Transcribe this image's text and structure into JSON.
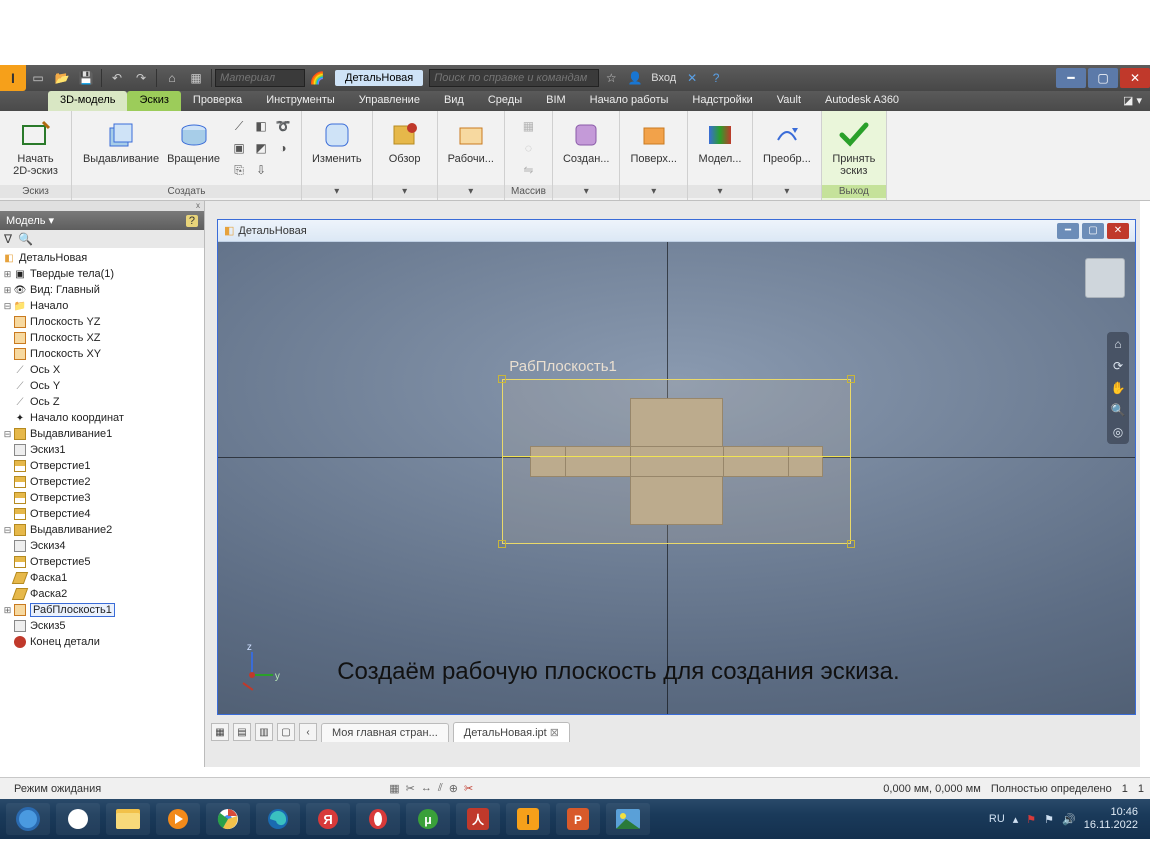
{
  "qat": {
    "logo": "I",
    "material_placeholder": "Материал",
    "doc_tab": "ДетальНовая",
    "search_placeholder": "Поиск по справке и командам",
    "login": "Вход"
  },
  "tabs": {
    "t3d": "3D-модель",
    "sketch": "Эскиз",
    "check": "Проверка",
    "tools": "Инструменты",
    "manage": "Управление",
    "view": "Вид",
    "env": "Среды",
    "bim": "BIM",
    "start": "Начало работы",
    "addins": "Надстройки",
    "vault": "Vault",
    "a360": "Autodesk A360"
  },
  "ribbon": {
    "sketch_panel": "Эскиз",
    "start_sketch": "Начать\n2D-эскиз",
    "create_panel": "Создать",
    "extrude": "Выдавливание",
    "revolve": "Вращение",
    "modify": "Изменить",
    "explore": "Обзор",
    "workfeat": "Рабочи...",
    "pattern_panel": "Массив",
    "createff": "Создан...",
    "surface": "Поверх...",
    "model": "Модел...",
    "convert": "Преобр...",
    "finish": "Принять\nэскиз",
    "exit_panel": "Выход"
  },
  "browser": {
    "title": "Модель",
    "root": "ДетальНовая",
    "solids": "Твердые тела(1)",
    "view": "Вид: Главный",
    "origin": "Начало",
    "pyz": "Плоскость YZ",
    "pxz": "Плоскость XZ",
    "pxy": "Плоскость XY",
    "ax": "Ось X",
    "ay": "Ось Y",
    "az": "Ось Z",
    "origin_pt": "Начало координат",
    "ext1": "Выдавливание1",
    "sk1": "Эскиз1",
    "h1": "Отверстие1",
    "h2": "Отверстие2",
    "h3": "Отверстие3",
    "h4": "Отверстие4",
    "ext2": "Выдавливание2",
    "sk4": "Эскиз4",
    "h5": "Отверстие5",
    "ch1": "Фаска1",
    "ch2": "Фаска2",
    "wp1": "РабПлоскость1",
    "sk5": "Эскиз5",
    "end": "Конец детали"
  },
  "viewport": {
    "doc_title": "ДетальНовая",
    "wp_label": "РабПлоскость1",
    "caption": "Создаём рабочую плоскость для создания эскиза.",
    "z": "z",
    "y": "y"
  },
  "doctabs": {
    "home": "Моя главная стран...",
    "active": "ДетальНовая.ipt"
  },
  "status": {
    "mode": "Режим ожидания",
    "coords": "0,000 мм, 0,000 мм",
    "constraint": "Полностью определено",
    "n1": "1",
    "n2": "1"
  },
  "taskbar": {
    "lang": "RU",
    "time": "10:46",
    "date": "16.11.2022"
  }
}
